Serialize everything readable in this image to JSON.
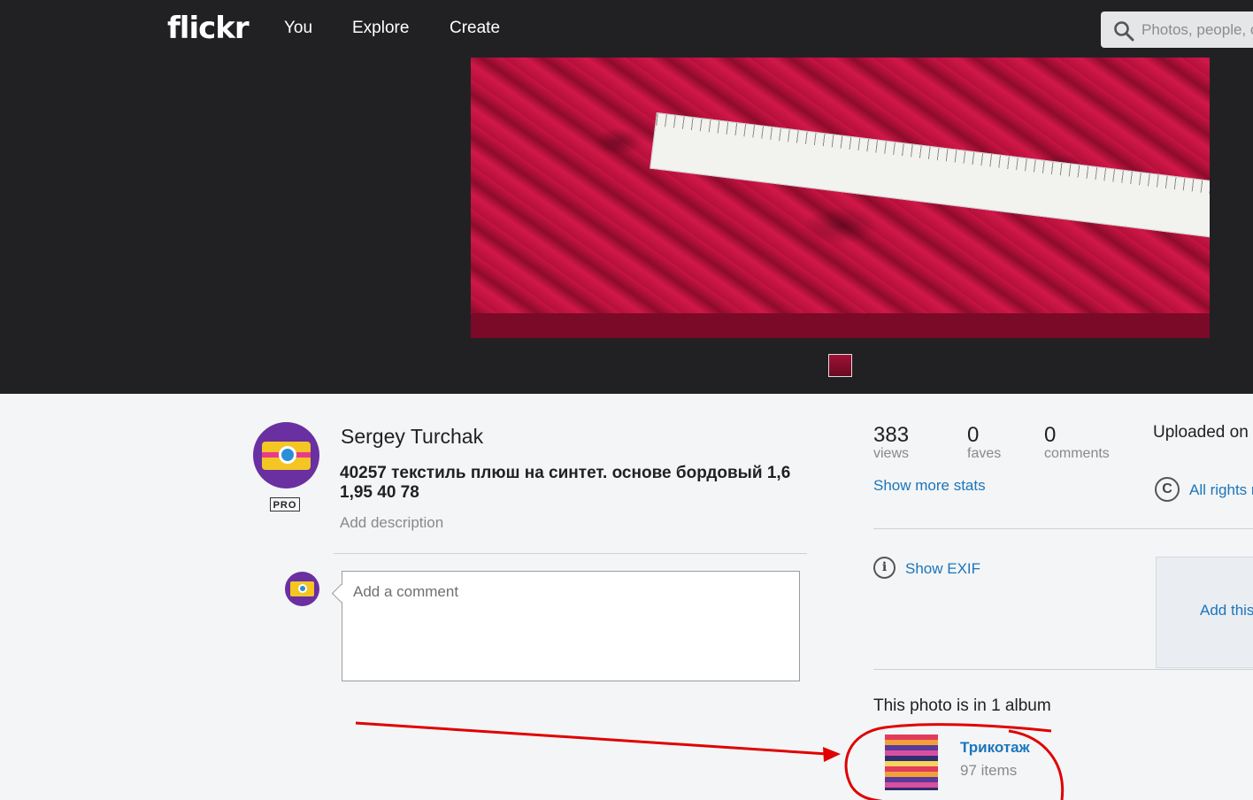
{
  "topbar": {
    "logo": "flickr",
    "nav": [
      "You",
      "Explore",
      "Create"
    ],
    "search_placeholder": "Photos, people, or groups"
  },
  "photo": {
    "author": "Sergey Turchak",
    "pro_badge": "PRO",
    "title": "40257 текстиль плюш на синтет. основе бордовый 1,6 1,95 40 78",
    "add_description": "Add description"
  },
  "comment": {
    "placeholder": "Add a comment"
  },
  "stats": {
    "views": "383",
    "views_label": "views",
    "faves": "0",
    "faves_label": "faves",
    "comments": "0",
    "comments_label": "comments",
    "more": "Show more stats"
  },
  "meta": {
    "uploaded": "Uploaded on",
    "rights": "All rights reserved",
    "exif": "Show EXIF",
    "add_to": "Add this photo to"
  },
  "album": {
    "heading": "This photo is in 1 album",
    "name": "Трикотаж",
    "count": "97 items"
  },
  "colors": {
    "topbar": "#212124",
    "link": "#1c75bc",
    "annotation": "#e00000"
  }
}
